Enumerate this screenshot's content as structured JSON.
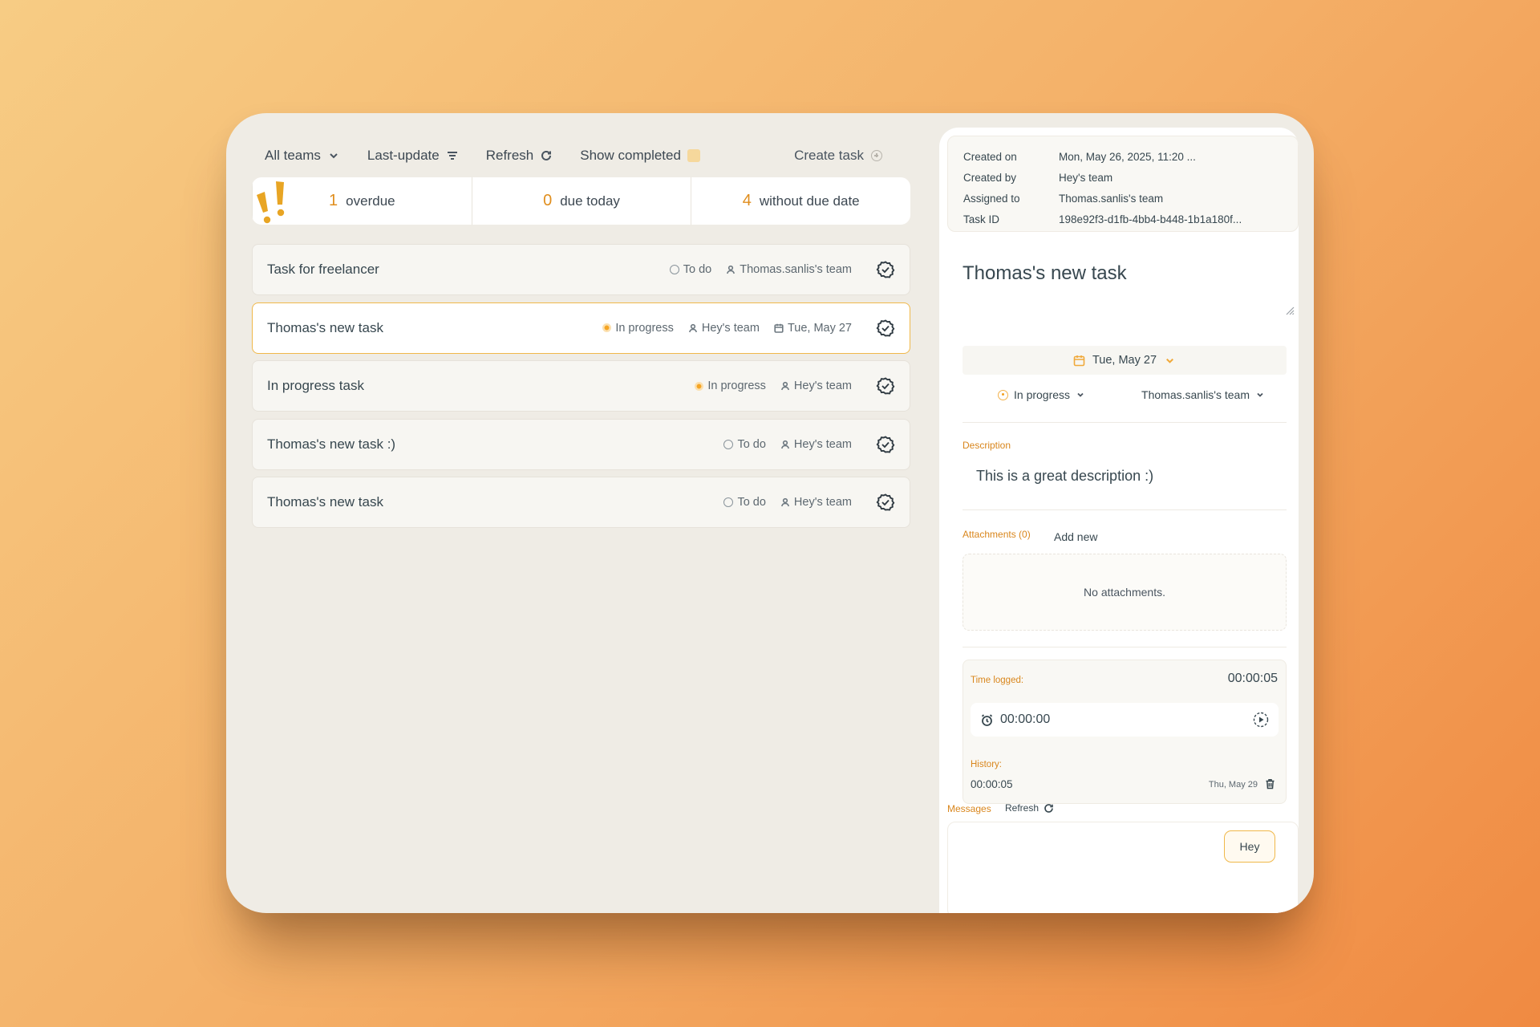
{
  "toolbar": {
    "teams_label": "All teams",
    "sort_label": "Last-update",
    "refresh_label": "Refresh",
    "show_completed_label": "Show completed",
    "create_task_label": "Create task"
  },
  "stats": {
    "overdue": {
      "count": "1",
      "label": "overdue"
    },
    "due_today": {
      "count": "0",
      "label": "due today"
    },
    "no_due": {
      "count": "4",
      "label": "without due date"
    }
  },
  "tasks": [
    {
      "title": "Task for freelancer",
      "status": "To do",
      "team": "Thomas.sanlis's team",
      "date": ""
    },
    {
      "title": "Thomas's new task",
      "status": "In progress",
      "team": "Hey's team",
      "date": "Tue, May 27"
    },
    {
      "title": "In progress task",
      "status": "In progress",
      "team": "Hey's team",
      "date": ""
    },
    {
      "title": "Thomas's new task :)",
      "status": "To do",
      "team": "Hey's team",
      "date": ""
    },
    {
      "title": "Thomas's new task",
      "status": "To do",
      "team": "Hey's team",
      "date": ""
    }
  ],
  "detail": {
    "info": [
      {
        "key": "Created on",
        "value": "Mon, May 26, 2025, 11:20 ..."
      },
      {
        "key": "Created by",
        "value": "Hey's team"
      },
      {
        "key": "Assigned to",
        "value": "Thomas.sanlis's team"
      },
      {
        "key": "Task ID",
        "value": "198e92f3-d1fb-4bb4-b448-1b1a180f..."
      }
    ],
    "title": "Thomas's new task",
    "due_date": "Tue, May 27",
    "status": "In progress",
    "team": "Thomas.sanlis's team",
    "description_label": "Description",
    "description": "This is a great description :)",
    "attachments_label": "Attachments (0)",
    "add_new_label": "Add new",
    "no_attachments": "No attachments.",
    "time_logged_label": "Time logged:",
    "time_logged_total": "00:00:05",
    "timer_value": "00:00:00",
    "history_label": "History:",
    "history": [
      {
        "duration": "00:00:05",
        "date": "Thu, May 29"
      }
    ],
    "messages_label": "Messages",
    "messages_refresh_label": "Refresh",
    "message_preview": "Hey"
  },
  "colors": {
    "accent": "#e08e1e",
    "selected_border": "#f0b84a"
  }
}
